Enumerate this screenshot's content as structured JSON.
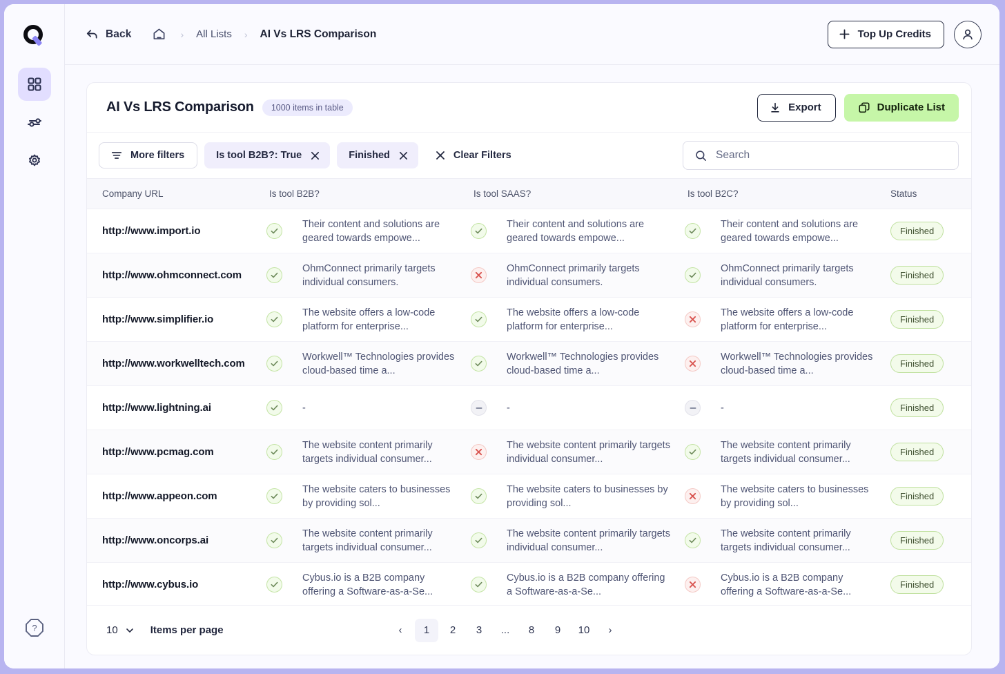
{
  "brand": {
    "logo_letter": "Q",
    "accent": "#8c85f5",
    "frame_color": "#b8b4f0"
  },
  "sidebar": {
    "items": [
      {
        "name": "grid-icon",
        "label": "Dashboard",
        "active": true
      },
      {
        "name": "sliders-icon",
        "label": "Workflows",
        "active": false
      },
      {
        "name": "gear-icon",
        "label": "Settings",
        "active": false
      }
    ],
    "help_label": "Help"
  },
  "topbar": {
    "back_label": "Back",
    "breadcrumb": {
      "home": "Home",
      "all_lists": "All Lists",
      "current": "AI Vs LRS Comparison",
      "separator": "›"
    },
    "top_up_label": "Top Up Credits",
    "top_up_plus": "+",
    "avatar_label": "Account"
  },
  "card": {
    "title": "AI Vs LRS Comparison",
    "items_badge": "1000 items in table",
    "export_label": "Export",
    "duplicate_label": "Duplicate List",
    "duplicate_color": "#c6f6a8"
  },
  "filters": {
    "more_filters_label": "More filters",
    "chips": [
      {
        "label": "Is tool B2B?: True"
      },
      {
        "label": "Finished"
      }
    ],
    "clear_label": "Clear Filters"
  },
  "search": {
    "placeholder": "Search",
    "value": ""
  },
  "table": {
    "columns": [
      "Company URL",
      "Is tool B2B?",
      "Is tool SAAS?",
      "Is tool B2C?",
      "Status"
    ],
    "rows": [
      {
        "url": "http://www.import.io",
        "b2b": {
          "mark": "yes",
          "text": "Their content and solutions are geared towards empowe..."
        },
        "saas": {
          "mark": "yes",
          "text": "Their content and solutions are geared towards empowe..."
        },
        "b2c": {
          "mark": "yes",
          "text": "Their content and solutions are geared towards empowe..."
        },
        "status": "Finished"
      },
      {
        "url": "http://www.ohmconnect.com",
        "b2b": {
          "mark": "yes",
          "text": "OhmConnect primarily targets individual consumers."
        },
        "saas": {
          "mark": "no",
          "text": "OhmConnect primarily targets individual consumers."
        },
        "b2c": {
          "mark": "yes",
          "text": "OhmConnect primarily targets individual consumers."
        },
        "status": "Finished"
      },
      {
        "url": "http://www.simplifier.io",
        "b2b": {
          "mark": "yes",
          "text": "The website offers a low-code platform for enterprise..."
        },
        "saas": {
          "mark": "yes",
          "text": "The website offers a low-code platform for enterprise..."
        },
        "b2c": {
          "mark": "no",
          "text": "The website offers a low-code platform for enterprise..."
        },
        "status": "Finished"
      },
      {
        "url": "http://www.workwelltech.com",
        "b2b": {
          "mark": "yes",
          "text": "Workwell™ Technologies provides cloud-based time a..."
        },
        "saas": {
          "mark": "yes",
          "text": "Workwell™ Technologies provides cloud-based time a..."
        },
        "b2c": {
          "mark": "no",
          "text": "Workwell™ Technologies provides cloud-based time a..."
        },
        "status": "Finished"
      },
      {
        "url": "http://www.lightning.ai",
        "b2b": {
          "mark": "yes",
          "text": "-"
        },
        "saas": {
          "mark": "na",
          "text": "-"
        },
        "b2c": {
          "mark": "na",
          "text": "-"
        },
        "status": "Finished"
      },
      {
        "url": "http://www.pcmag.com",
        "b2b": {
          "mark": "yes",
          "text": "The website content primarily targets individual consumer..."
        },
        "saas": {
          "mark": "no",
          "text": "The website content primarily targets individual consumer..."
        },
        "b2c": {
          "mark": "yes",
          "text": "The website content primarily targets individual consumer..."
        },
        "status": "Finished"
      },
      {
        "url": "http://www.appeon.com",
        "b2b": {
          "mark": "yes",
          "text": "The website caters to businesses by providing sol..."
        },
        "saas": {
          "mark": "yes",
          "text": "The website caters to businesses by providing sol..."
        },
        "b2c": {
          "mark": "no",
          "text": "The website caters to businesses by providing sol..."
        },
        "status": "Finished"
      },
      {
        "url": "http://www.oncorps.ai",
        "b2b": {
          "mark": "yes",
          "text": "The website content primarily targets individual consumer..."
        },
        "saas": {
          "mark": "yes",
          "text": "The website content primarily targets individual consumer..."
        },
        "b2c": {
          "mark": "yes",
          "text": "The website content primarily targets individual consumer..."
        },
        "status": "Finished"
      },
      {
        "url": "http://www.cybus.io",
        "b2b": {
          "mark": "yes",
          "text": "Cybus.io is a B2B company offering a Software-as-a-Se..."
        },
        "saas": {
          "mark": "yes",
          "text": "Cybus.io is a B2B company offering a Software-as-a-Se..."
        },
        "b2c": {
          "mark": "no",
          "text": "Cybus.io is a B2B company offering a Software-as-a-Se..."
        },
        "status": "Finished"
      }
    ]
  },
  "pagination": {
    "per_page_value": "10",
    "per_page_label": "Items per page",
    "prev": "‹",
    "next": "›",
    "pages": [
      "1",
      "2",
      "3",
      "...",
      "8",
      "9",
      "10"
    ],
    "current_page": "1"
  }
}
